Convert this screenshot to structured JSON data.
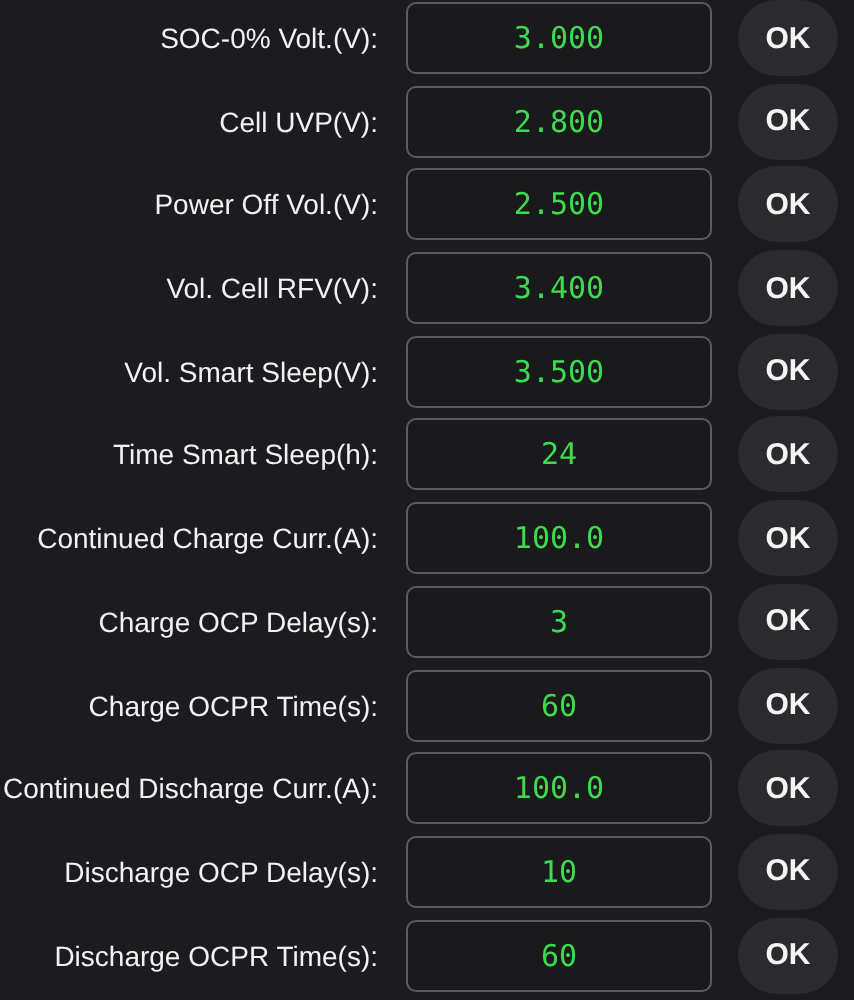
{
  "settings": [
    {
      "label": "SOC-0% Volt.(V):",
      "value": "3.000",
      "button": "OK"
    },
    {
      "label": "Cell UVP(V):",
      "value": "2.800",
      "button": "OK"
    },
    {
      "label": "Power Off Vol.(V):",
      "value": "2.500",
      "button": "OK"
    },
    {
      "label": "Vol. Cell RFV(V):",
      "value": "3.400",
      "button": "OK"
    },
    {
      "label": "Vol. Smart Sleep(V):",
      "value": "3.500",
      "button": "OK"
    },
    {
      "label": "Time Smart Sleep(h):",
      "value": "24",
      "button": "OK"
    },
    {
      "label": "Continued Charge Curr.(A):",
      "value": "100.0",
      "button": "OK"
    },
    {
      "label": "Charge OCP Delay(s):",
      "value": "3",
      "button": "OK"
    },
    {
      "label": "Charge OCPR Time(s):",
      "value": "60",
      "button": "OK"
    },
    {
      "label": "Continued Discharge Curr.(A):",
      "value": "100.0",
      "button": "OK"
    },
    {
      "label": "Discharge OCP Delay(s):",
      "value": "10",
      "button": "OK"
    },
    {
      "label": "Discharge OCPR Time(s):",
      "value": "60",
      "button": "OK"
    }
  ]
}
